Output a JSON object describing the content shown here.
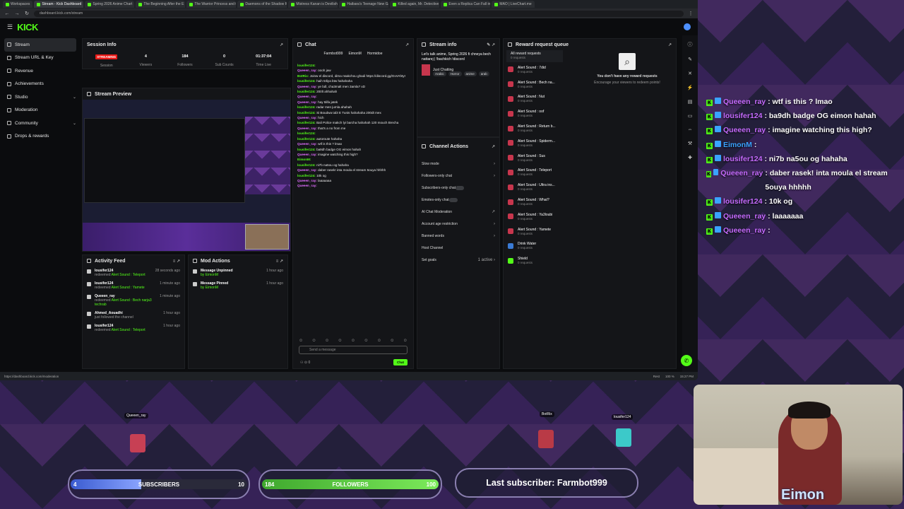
{
  "browser": {
    "tabs": [
      "Workspaces",
      "Stream - Kick Dashboard",
      "Spring 2026 Anime Chart",
      "The Beginning After the E",
      "The Warrior Princess and t",
      "Daemons of the Shadow R",
      "Mistress Kanan is Devilish",
      "Haibara's Teenage New Ga",
      "Killed again, Mr. Detective",
      "Even a Replica Can Fall in L",
      "MAO | LiveChart.me"
    ],
    "url": "dashboard.kick.com/stream",
    "status_url": "https://dashboard.kick.com/moderation",
    "status_right": "Rest",
    "zoom": "100 %",
    "clock": "15:27 PM"
  },
  "app": {
    "logo": "KICK"
  },
  "sidebar": {
    "items": [
      {
        "label": "Stream"
      },
      {
        "label": "Stream URL & Key"
      },
      {
        "label": "Revenue"
      },
      {
        "label": "Achievements"
      },
      {
        "label": "Studio"
      },
      {
        "label": "Moderation"
      },
      {
        "label": "Community"
      },
      {
        "label": "Drops & rewards"
      }
    ]
  },
  "session": {
    "title": "Session Info",
    "live_badge": "STREAMING",
    "stats": [
      {
        "value": "",
        "label": "Session"
      },
      {
        "value": "4",
        "label": "Viewers"
      },
      {
        "value": "184",
        "label": "Followers"
      },
      {
        "value": "0",
        "label": "Sub Counts"
      },
      {
        "value": "01:37:04",
        "label": "Time Live"
      }
    ]
  },
  "preview": {
    "title": "Stream Preview"
  },
  "activity": {
    "title": "Activity Feed",
    "rows": [
      {
        "name": "lousifer124",
        "action": "redeemed",
        "item": "Alert Sound : Teleport",
        "time": "28 seconds ago"
      },
      {
        "name": "lousifer124",
        "action": "redeemed",
        "item": "Alert Sound : Yamete",
        "time": "1 minute ago"
      },
      {
        "name": "Queeen_ray",
        "action": "redeemed",
        "item": "Alert Sound : Bech narja3 techrab",
        "time": "1 minute ago"
      },
      {
        "name": "Ahmed_Aouadhi",
        "action": "just followed the channel",
        "item": "",
        "time": "1 hour ago"
      },
      {
        "name": "lousifer124",
        "action": "redeemed",
        "item": "Alert Sound : Teleport",
        "time": "1 hour ago"
      }
    ]
  },
  "modactions": {
    "title": "Mod Actions",
    "rows": [
      {
        "name": "Message Unpinned",
        "by": "by EimonM",
        "time": "1 hour ago"
      },
      {
        "name": "Message Pinned",
        "by": "by EimonM",
        "time": "1 hour ago"
      }
    ]
  },
  "chat": {
    "title": "Chat",
    "top_users": [
      "Farmbot999",
      "EimonM",
      "Hormidoe"
    ],
    "messages": [
      {
        "user": "lousifer124:",
        "text": "",
        "pink": false
      },
      {
        "user": "Queeen_ray:",
        "text": "oooh jaw",
        "pink": true
      },
      {
        "user": "BotRix:",
        "text": "Joinw el discord, dima nsakchou ghadi https://discord.gg/GvVAhtyr",
        "pink": false
      },
      {
        "user": "lousifer124:",
        "text": "haih 5Iliya btw hahahaha",
        "pink": false
      },
      {
        "user": "Queeen_ray:",
        "text": "ye bdl, cha3malt men 3amla? xD",
        "pink": true
      },
      {
        "user": "lousifer124:",
        "text": "200lt ahhahah",
        "pink": false
      },
      {
        "user": "Queeen_ray:",
        "text": "",
        "pink": true
      },
      {
        "user": "Queeen_ray:",
        "text": "hay 5lifa jatek",
        "pink": true
      },
      {
        "user": "lousifer124:",
        "text": "radar men jumla ahahah",
        "pink": false
      },
      {
        "user": "lousifer124:",
        "text": "Si Boudwa tal3 E Tunis hahahaha 200dt mex",
        "pink": false
      },
      {
        "user": "Queeen_ray:",
        "text": "hich",
        "pink": true
      },
      {
        "user": "lousifer124:",
        "text": "Bali Police makch lyi barcha hahahah 120 mouch Brecha",
        "pink": false
      },
      {
        "user": "Queeen_ray:",
        "text": "that's a no from me",
        "pink": true
      },
      {
        "user": "lousifer124:",
        "text": "",
        "pink": false
      },
      {
        "user": "lousifer124:",
        "text": "autoroute hahaha",
        "pink": false
      },
      {
        "user": "Queeen_ray:",
        "text": "wtf is this ? lmao",
        "pink": true
      },
      {
        "user": "lousifer124:",
        "text": "ba9dh badge OG eimon hahah",
        "pink": false
      },
      {
        "user": "Queeen_ray:",
        "text": "imagine watching this high?",
        "pink": true
      },
      {
        "user": "EimonM:",
        "text": "",
        "pink": false
      },
      {
        "user": "lousifer124:",
        "text": "ni7b na5ou og hahaha",
        "pink": false
      },
      {
        "user": "Queeen_ray:",
        "text": "daber rasek! inta moula el stream 5ouya hhhhh",
        "pink": true
      },
      {
        "user": "lousifer124:",
        "text": "10k og",
        "pink": false
      },
      {
        "user": "Queeen_ray:",
        "text": "laaaaaaa",
        "pink": true
      },
      {
        "user": "Queeen_ray:",
        "text": "",
        "pink": true
      }
    ],
    "placeholder": "Send a message",
    "send": "Chat",
    "count": "0"
  },
  "streaminfo": {
    "title": "Stream info",
    "stream_title": "Let's talk anime, Spring 2026 fi chneya bech nattarej | !bachkich !discord",
    "category": "Just Chatting",
    "tags": [
      "Arabic",
      "Horror",
      "anime",
      "arab"
    ]
  },
  "channel_actions": {
    "title": "Channel Actions",
    "rows": [
      {
        "label": "Slow mode",
        "right": "›"
      },
      {
        "label": "Followers-only chat",
        "right": "›"
      },
      {
        "label": "Subscribers-only chat",
        "right": "toggle"
      },
      {
        "label": "Emotes-only chat",
        "right": "toggle"
      },
      {
        "label": "AI Chat Moderation",
        "right": "↗"
      },
      {
        "label": "Account age restriction",
        "right": "›"
      },
      {
        "label": "Banned words",
        "right": "›"
      },
      {
        "label": "Host Channel",
        "right": ""
      },
      {
        "label": "Set goals",
        "right": "1 active ›"
      }
    ]
  },
  "reward": {
    "title": "Reward request queue",
    "all": "All reward requests",
    "all_count": "0 requests",
    "items": [
      {
        "name": "Alert Sound : 7did",
        "count": "0 requests"
      },
      {
        "name": "Alert Sound : Bech na...",
        "count": "0 requests"
      },
      {
        "name": "Alert Sound : Nut",
        "count": "0 requests"
      },
      {
        "name": "Alert Sound : oof",
        "count": "0 requests"
      },
      {
        "name": "Alert Sound : Return b...",
        "count": "0 requests"
      },
      {
        "name": "Alert Sound : Spiderm...",
        "count": "0 requests"
      },
      {
        "name": "Alert Sound : Sus",
        "count": "0 requests"
      },
      {
        "name": "Alert Sound : Teleport",
        "count": "0 requests"
      },
      {
        "name": "Alert Sound : Ultra ins...",
        "count": "0 requests"
      },
      {
        "name": "Alert Sound : What?",
        "count": "0 requests"
      },
      {
        "name": "Alert Sound : Ya3loubi",
        "count": "0 requests"
      },
      {
        "name": "Alert Sound : Yamete",
        "count": "0 requests"
      },
      {
        "name": "Drink Water",
        "count": "0 requests"
      },
      {
        "name": "Shield",
        "count": "0 requests"
      }
    ],
    "empty_title": "You don't have any reward requests",
    "empty_sub": "Encourage your viewers to redeem points!"
  },
  "overlay_chat": [
    {
      "user": "Queeen_ray",
      "msg": ": wtf is this ? lmao",
      "mod": false
    },
    {
      "user": "lousifer124",
      "msg": ": ba9dh badge OG eimon hahah",
      "mod": false
    },
    {
      "user": "Queeen_ray",
      "msg": ": imagine watching this high?",
      "mod": false
    },
    {
      "user": "EimonM",
      "msg": ":",
      "mod": true
    },
    {
      "user": "lousifer124",
      "msg": ": ni7b na5ou og hahaha",
      "mod": false
    },
    {
      "user": "Queeen_ray",
      "msg": ": daber rasek! inta moula el stream 5ouya hhhhh",
      "mod": false
    },
    {
      "user": "lousifer124",
      "msg": ": 10k og",
      "mod": false
    },
    {
      "user": "Queeen_ray",
      "msg": ": laaaaaaa",
      "mod": false
    },
    {
      "user": "Queeen_ray",
      "msg": ":",
      "mod": false
    }
  ],
  "overlay": {
    "subs": {
      "label": "SUBSCRIBERS",
      "current": "4",
      "goal": "10",
      "progress": 0.4
    },
    "followers": {
      "label": "FOLLOWERS",
      "current": "184",
      "goal": "100",
      "progress": 1.0
    },
    "last_sub": "Last subscriber: Farmbot999",
    "cam_name": "Eimon",
    "avatars": [
      {
        "name": "Queeen_ray"
      },
      {
        "name": "BotRix"
      },
      {
        "name": "lousifer124"
      }
    ]
  },
  "colors": {
    "kick_green": "#53fc18",
    "live_red": "#e91916",
    "user_pink": "#e26eff",
    "mod_blue": "#3aa3ff"
  }
}
